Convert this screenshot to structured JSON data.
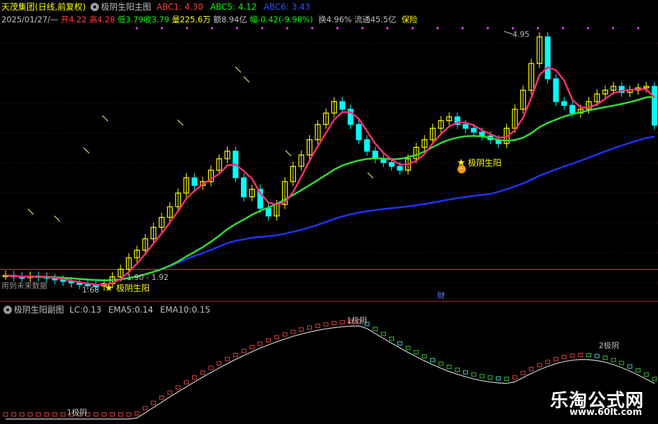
{
  "header": {
    "stock_name": "天茂集团",
    "period": "(日线,前复权)",
    "indicator_name": "极阴生阳主图",
    "abc1_label": "ABC1:",
    "abc1_value": "4.30",
    "abc5_label": "ABC5:",
    "abc5_value": "4.12",
    "abc6_label": "ABC6:",
    "abc6_value": "3.43",
    "date": "2025/01/27/—",
    "open_label": "开",
    "open_value": "4.22",
    "high_label": "高",
    "high_value": "4.28",
    "low_label": "低",
    "low_value": "3.79",
    "close_label": "收",
    "close_value": "3.79",
    "volume_label": "量",
    "volume_value": "225.6万",
    "amount_label": "额",
    "amount_value": "8.94亿",
    "change_label": "幅",
    "change_value": "-0.42(-9.98%)",
    "turnover_label": "换",
    "turnover_value": "4.96%",
    "float_label": "流通",
    "float_value": "45.5亿",
    "sector": "保险"
  },
  "sub_header": {
    "indicator_name": "极阴生阳副图",
    "lc_label": "LC:",
    "lc_value": "0.13",
    "ema5_label": "EMA5:",
    "ema5_value": "0.14",
    "ema10_label": "EMA10:",
    "ema10_value": "0.15"
  },
  "annotations": {
    "top_price": "4.95",
    "low_price": "1.68",
    "range_text": "1.90 - 1.92",
    "signal1": "极阴生阳",
    "signal2": "极阴生阳",
    "future_data_text": "用到未来数据",
    "finance_marker": "财",
    "sub_marker1": "1极阴",
    "sub_marker2": "2极阴",
    "sub_marker_top": "1极阴"
  },
  "watermark": {
    "cn": "乐淘公式网",
    "url": "www.60lt.com"
  },
  "colors": {
    "up": "#ffff00",
    "down": "#00ffff",
    "ma_pink": "#ff2d7a",
    "ma_green": "#33dd33",
    "ma_blue": "#2233ff",
    "abc1": "#ff4040",
    "abc5": "#00ff00",
    "abc6": "#3050ff",
    "divider": "#b03030"
  },
  "chart_data": {
    "type": "line",
    "series": [],
    "price_candles_close_approx": [
      1.82,
      1.8,
      1.79,
      1.81,
      1.8,
      1.78,
      1.76,
      1.74,
      1.72,
      1.7,
      1.69,
      1.68,
      1.71,
      1.8,
      1.9,
      2.05,
      2.15,
      2.3,
      2.45,
      2.58,
      2.72,
      2.9,
      3.1,
      3.0,
      3.05,
      3.2,
      3.35,
      3.45,
      3.1,
      2.85,
      2.95,
      2.7,
      2.6,
      2.75,
      3.05,
      3.25,
      3.4,
      3.6,
      3.8,
      3.95,
      4.1,
      4.0,
      3.8,
      3.6,
      3.45,
      3.35,
      3.3,
      3.25,
      3.2,
      3.35,
      3.5,
      3.6,
      3.75,
      3.85,
      3.9,
      3.8,
      3.75,
      3.7,
      3.65,
      3.6,
      3.55,
      3.75,
      4.0,
      4.25,
      4.6,
      4.95,
      4.4,
      4.1,
      4.05,
      3.95,
      4.0,
      4.1,
      4.2,
      4.25,
      4.3,
      4.22,
      4.25,
      4.28,
      4.3,
      3.79
    ]
  }
}
